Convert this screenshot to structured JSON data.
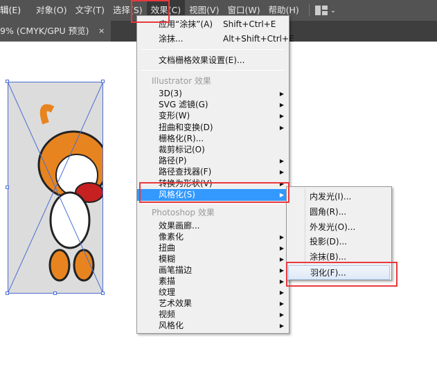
{
  "menubar": {
    "items": [
      "编辑(E)",
      "对象(O)",
      "文字(T)",
      "选择(S)",
      "效果(C)",
      "视图(V)",
      "窗口(W)",
      "帮助(H)"
    ],
    "partial_first": "辑(E)"
  },
  "tab": {
    "title": "9% (CMYK/GPU 预览)",
    "close": "×"
  },
  "effect_menu": {
    "apply": {
      "label": "应用“涂抹”(A)",
      "shortcut": "Shift+Ctrl+E"
    },
    "scribble": {
      "label": "涂抹...",
      "shortcut": "Alt+Shift+Ctrl+E"
    },
    "doc_raster": "文档栅格效果设置(E)...",
    "illustrator_header": "Illustrator 效果",
    "illustrator_items": [
      {
        "label": "3D(3)",
        "sub": true
      },
      {
        "label": "SVG 滤镜(G)",
        "sub": true
      },
      {
        "label": "变形(W)",
        "sub": true
      },
      {
        "label": "扭曲和变换(D)",
        "sub": true
      },
      {
        "label": "栅格化(R)...",
        "sub": false
      },
      {
        "label": "裁剪标记(O)",
        "sub": false
      },
      {
        "label": "路径(P)",
        "sub": true
      },
      {
        "label": "路径查找器(F)",
        "sub": true
      },
      {
        "label": "转换为形状(V)",
        "sub": true
      },
      {
        "label": "风格化(S)",
        "sub": true
      }
    ],
    "photoshop_header": "Photoshop 效果",
    "photoshop_items": [
      {
        "label": "效果画廊...",
        "sub": false
      },
      {
        "label": "像素化",
        "sub": true
      },
      {
        "label": "扭曲",
        "sub": true
      },
      {
        "label": "模糊",
        "sub": true
      },
      {
        "label": "画笔描边",
        "sub": true
      },
      {
        "label": "素描",
        "sub": true
      },
      {
        "label": "纹理",
        "sub": true
      },
      {
        "label": "艺术效果",
        "sub": true
      },
      {
        "label": "视频",
        "sub": true
      },
      {
        "label": "风格化",
        "sub": true
      }
    ]
  },
  "stylize_submenu": [
    "内发光(I)...",
    "圆角(R)...",
    "外发光(O)...",
    "投影(D)...",
    "涂抹(B)...",
    "羽化(F)..."
  ],
  "colors": {
    "highlight": "#3399ff",
    "annotation": "#e8383d"
  }
}
